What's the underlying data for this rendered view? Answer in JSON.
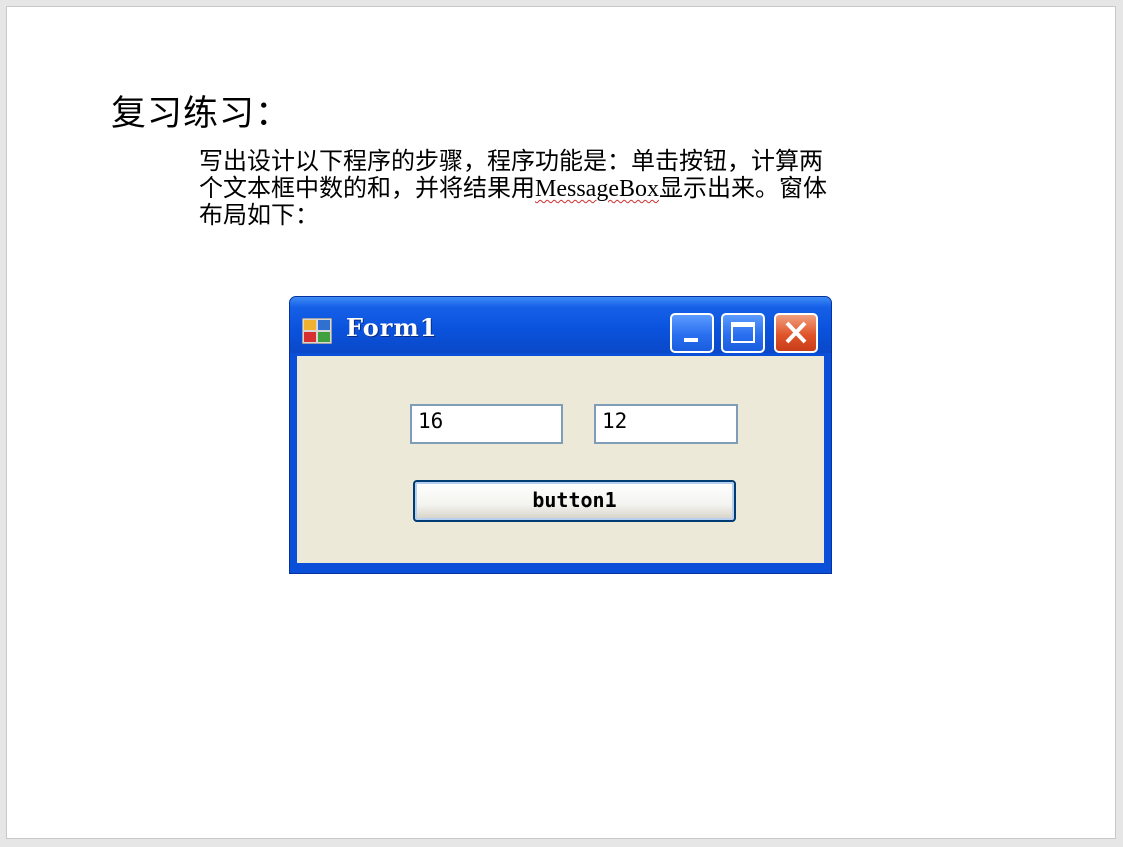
{
  "slide": {
    "title": "复习练习：",
    "instructions": {
      "line1": "写出设计以下程序的步骤，程序功能是：单击按钮，计算两",
      "line2_before": "个文本框中数的和，并将结果用",
      "line2_highlight": "MessageBox",
      "line2_after": "显示出来。窗体",
      "line3": "布局如下："
    }
  },
  "window": {
    "title": "Form1",
    "textbox1_value": "16",
    "textbox2_value": "12",
    "button_label": "button1",
    "colors": {
      "titlebar": "#0a52dc",
      "client": "#ece9d8",
      "close": "#e0552a"
    }
  }
}
